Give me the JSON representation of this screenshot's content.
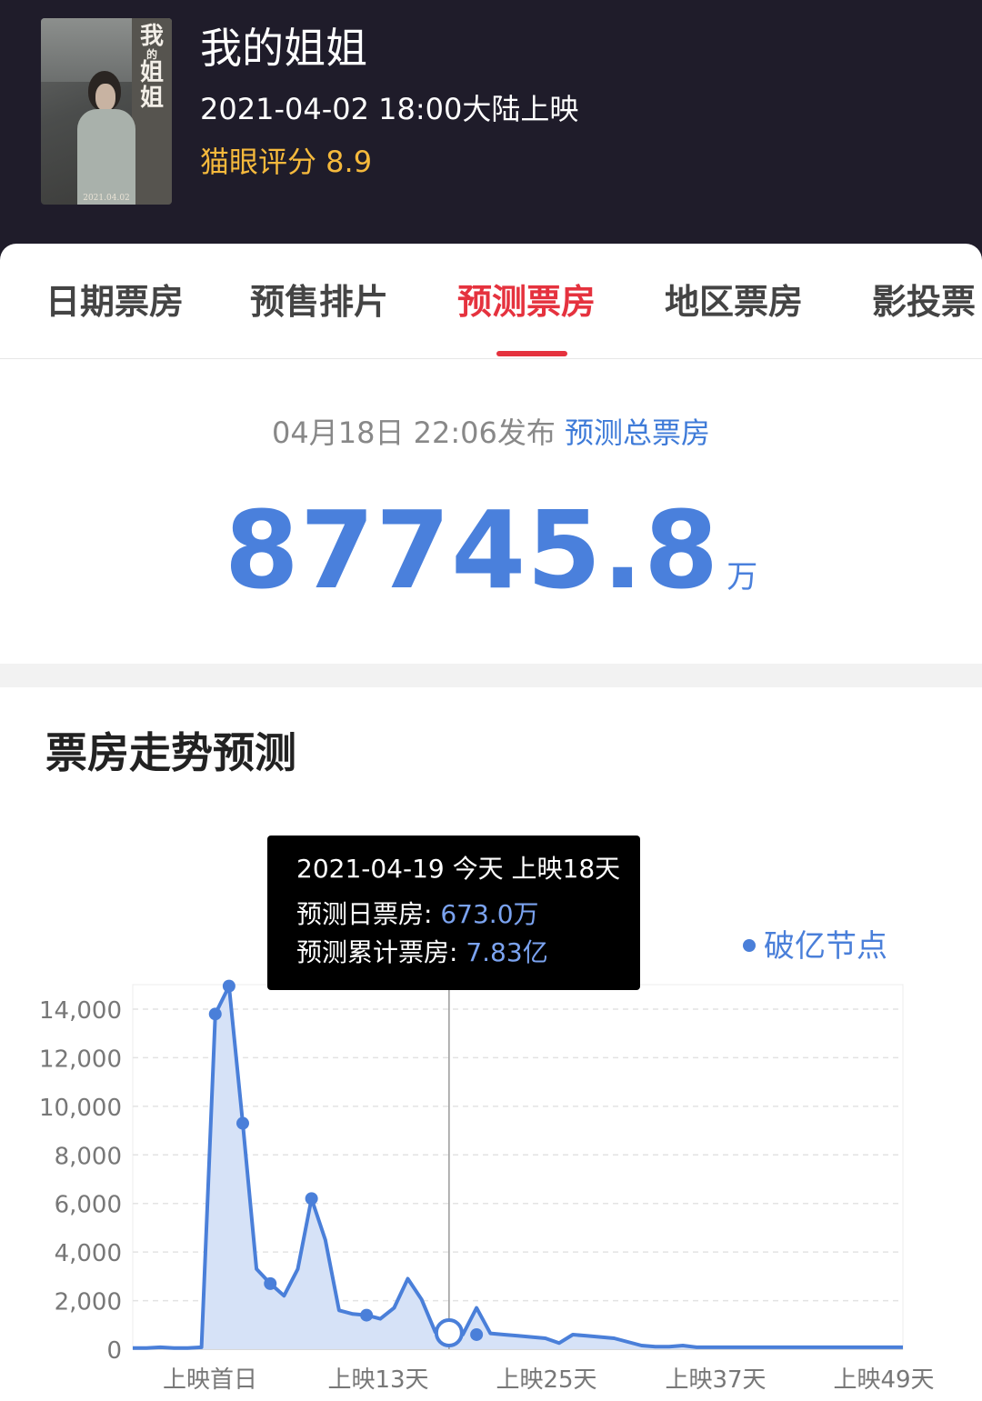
{
  "movie": {
    "title": "我的姐姐",
    "release": "2021-04-02 18:00大陆上映",
    "rating": "猫眼评分 8.9",
    "poster": {
      "title_chars": [
        "我",
        "的",
        "姐",
        "姐"
      ],
      "date": "2021.04.02"
    }
  },
  "tabs": [
    {
      "label": "日期票房",
      "active": false
    },
    {
      "label": "预售排片",
      "active": false
    },
    {
      "label": "预测票房",
      "active": true
    },
    {
      "label": "地区票房",
      "active": false
    },
    {
      "label": "影投票",
      "active": false
    }
  ],
  "forecast": {
    "published": "04月18日 22:06发布",
    "link": "预测总票房",
    "total": "87745.8",
    "unit": "万"
  },
  "section_title": "票房走势预测",
  "tooltip": {
    "line1": "2021-04-19 今天 上映18天",
    "daily_label": "预测日票房: ",
    "daily_value": "673.0万",
    "cum_label": "预测累计票房: ",
    "cum_value": "7.83亿"
  },
  "colors": {
    "accent": "#4a80dc",
    "active_tab": "#e5323e",
    "rating": "#f5b93c",
    "header_bg": "#1f1c2a"
  },
  "chart_data": {
    "type": "area",
    "x_ticks": [
      "上映首日",
      "上映13天",
      "上映25天",
      "上映37天",
      "上映49天"
    ],
    "y_ticks": [
      "0",
      "2,000",
      "4,000",
      "6,000",
      "8,000",
      "10,000",
      "12,000",
      "14,000"
    ],
    "ylim": [
      0,
      15000
    ],
    "legend": "破亿节点",
    "legend_position": "top-right",
    "grid": true,
    "x": [
      -6,
      -5,
      -4,
      -3,
      -2,
      -1,
      0,
      1,
      2,
      3,
      4,
      5,
      6,
      7,
      8,
      9,
      10,
      11,
      12,
      13,
      14,
      15,
      16,
      17,
      18,
      19,
      20,
      21,
      22,
      23,
      24,
      25,
      26,
      27,
      28,
      29,
      30,
      31,
      32,
      33,
      34,
      35,
      36,
      37,
      38,
      39,
      40,
      41,
      42,
      43,
      44,
      45,
      46,
      47,
      48,
      49,
      50
    ],
    "values": [
      50,
      50,
      80,
      50,
      50,
      80,
      13800,
      14950,
      9300,
      3300,
      2700,
      2200,
      3300,
      6200,
      4500,
      1600,
      1450,
      1400,
      1250,
      1700,
      2900,
      2050,
      700,
      650,
      600,
      1700,
      650,
      600,
      550,
      500,
      450,
      250,
      600,
      550,
      500,
      450,
      300,
      150,
      100,
      100,
      150,
      80,
      80,
      80,
      80,
      80,
      80,
      80,
      80,
      80,
      80,
      80,
      80,
      80,
      80,
      80,
      80
    ],
    "markers": [
      {
        "x": 0,
        "y": 13800
      },
      {
        "x": 1,
        "y": 14950
      },
      {
        "x": 2,
        "y": 9300
      },
      {
        "x": 4,
        "y": 2700
      },
      {
        "x": 7,
        "y": 6200
      },
      {
        "x": 11,
        "y": 1400
      },
      {
        "x": 19,
        "y": 600
      }
    ],
    "highlight": {
      "x": 17,
      "y": 673
    }
  }
}
